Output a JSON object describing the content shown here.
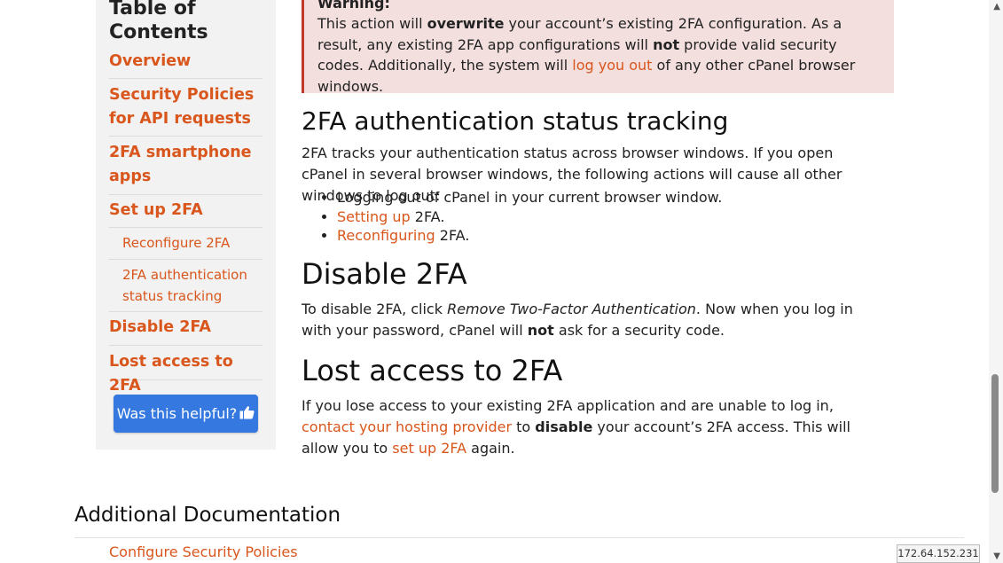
{
  "toc": {
    "title": "Table of Contents",
    "items": [
      {
        "label": "Overview"
      },
      {
        "label": "Security Policies for API requests"
      },
      {
        "label": "2FA smartphone apps"
      },
      {
        "label": "Set up 2FA"
      },
      {
        "label": "Reconfigure 2FA"
      },
      {
        "label": "2FA authentication status tracking"
      },
      {
        "label": "Disable 2FA"
      },
      {
        "label": "Lost access to 2FA"
      }
    ],
    "helpful_label": "Was this helpful?",
    "helpful_icon": "thumbs-up-icon"
  },
  "warning": {
    "title": "Warning:",
    "t1": "This action will ",
    "b1": "overwrite",
    "t2": " your account’s existing 2FA configuration. As a result, any existing 2FA app configurations will ",
    "b2": "not",
    "t3": " provide valid security codes. Additionally, the system will ",
    "link": "log you out",
    "t4": " of any other cPanel browser windows."
  },
  "tracking": {
    "heading": "2FA authentication status tracking",
    "intro": "2FA tracks your authentication status across browser windows. If you open cPanel in several browser windows, the following actions will cause all other windows to log out:",
    "b1": "Logging out of cPanel in your current browser window.",
    "b2_link": "Setting up",
    "b2_rest": " 2FA.",
    "b3_link": "Reconfiguring",
    "b3_rest": " 2FA."
  },
  "disable": {
    "heading": "Disable 2FA",
    "t1": "To disable 2FA, click ",
    "italic": "Remove Two-Factor Authentication",
    "t2": ". Now when you log in with your password, cPanel will ",
    "bold": "not",
    "t3": " ask for a security code."
  },
  "lost": {
    "heading": "Lost access to 2FA",
    "t1": "If you lose access to your existing 2FA application and are unable to log in, ",
    "link1": "contact your hosting provider",
    "t2": " to ",
    "bold": "disable",
    "t3": " your account’s 2FA access. This will allow you to ",
    "link2": "set up 2FA",
    "t4": " again."
  },
  "additional": {
    "heading": "Additional Documentation",
    "link": "Configure Security Policies"
  },
  "status": {
    "ip": "172.64.152.231"
  }
}
